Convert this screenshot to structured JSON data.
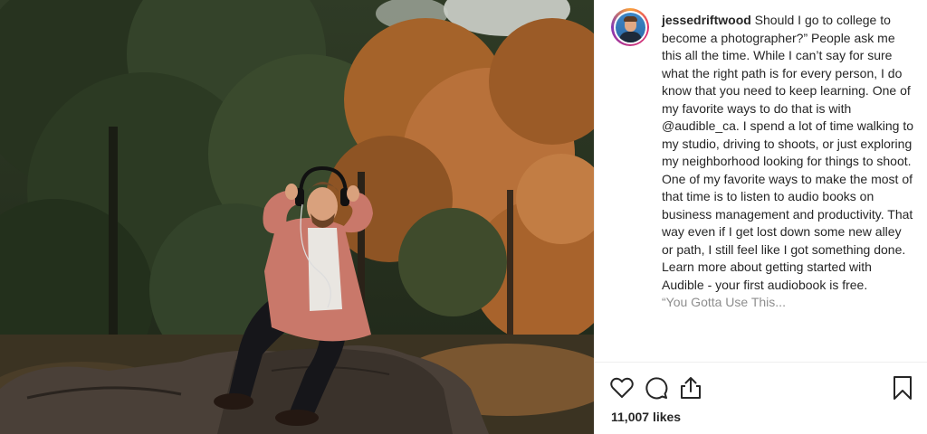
{
  "post": {
    "username": "jessedriftwood",
    "caption": " Should I go to college to become a photographer?” People ask me this all the time. While I can’t say for sure what the right path is for every person, I do know that you need to keep learning. One of my favorite ways to do that is with @audible_ca. I spend a lot of time walking to my studio, driving to shoots, or just exploring my neighborhood looking for things to shoot. One of my favorite ways to make the most of that time is to listen to audio books on business management and productivity. That way even if I get lost down some new alley or path, I still feel like I got something done. Learn more about getting started with Audible - your first audiobook is free.",
    "caption_more": "“You Gotta Use This...",
    "likes": "11,007 likes"
  },
  "icons": {
    "like": "heart-icon",
    "comment": "comment-icon",
    "share": "share-icon",
    "save": "bookmark-icon"
  },
  "colors": {
    "text": "#262626",
    "border": "#efefef",
    "muted": "#8e8e8e"
  }
}
